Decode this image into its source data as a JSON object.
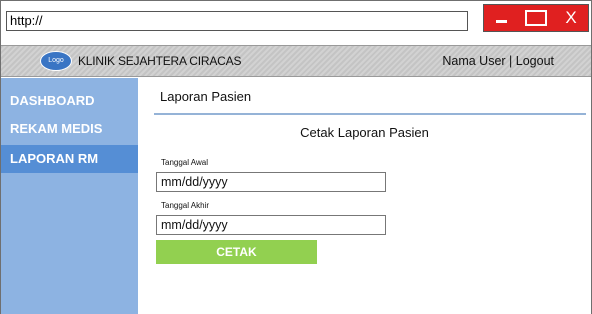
{
  "browser": {
    "url": "http://",
    "close_label": "X"
  },
  "header": {
    "logo_text": "Logo",
    "clinic_name": "KLINIK SEJAHTERA CIRACAS",
    "user_links": "Nama User | Logout"
  },
  "sidebar": {
    "items": [
      {
        "label": "DASHBOARD",
        "active": false
      },
      {
        "label": "REKAM MEDIS",
        "active": false
      },
      {
        "label": "LAPORAN RM",
        "active": true
      }
    ]
  },
  "main": {
    "page_title": "Laporan Pasien",
    "form_title": "Cetak Laporan Pasien",
    "start_label": "Tanggal Awal",
    "start_placeholder": "mm/dd/yyyy",
    "end_label": "Tanggal Akhir",
    "end_placeholder": "mm/dd/yyyy",
    "print_button": "CETAK"
  },
  "colors": {
    "sidebar_bg": "#8db3e2",
    "sidebar_active": "#558ed5",
    "button_green": "#92d050",
    "window_red": "#e02020",
    "logo_blue": "#3a75c4"
  }
}
